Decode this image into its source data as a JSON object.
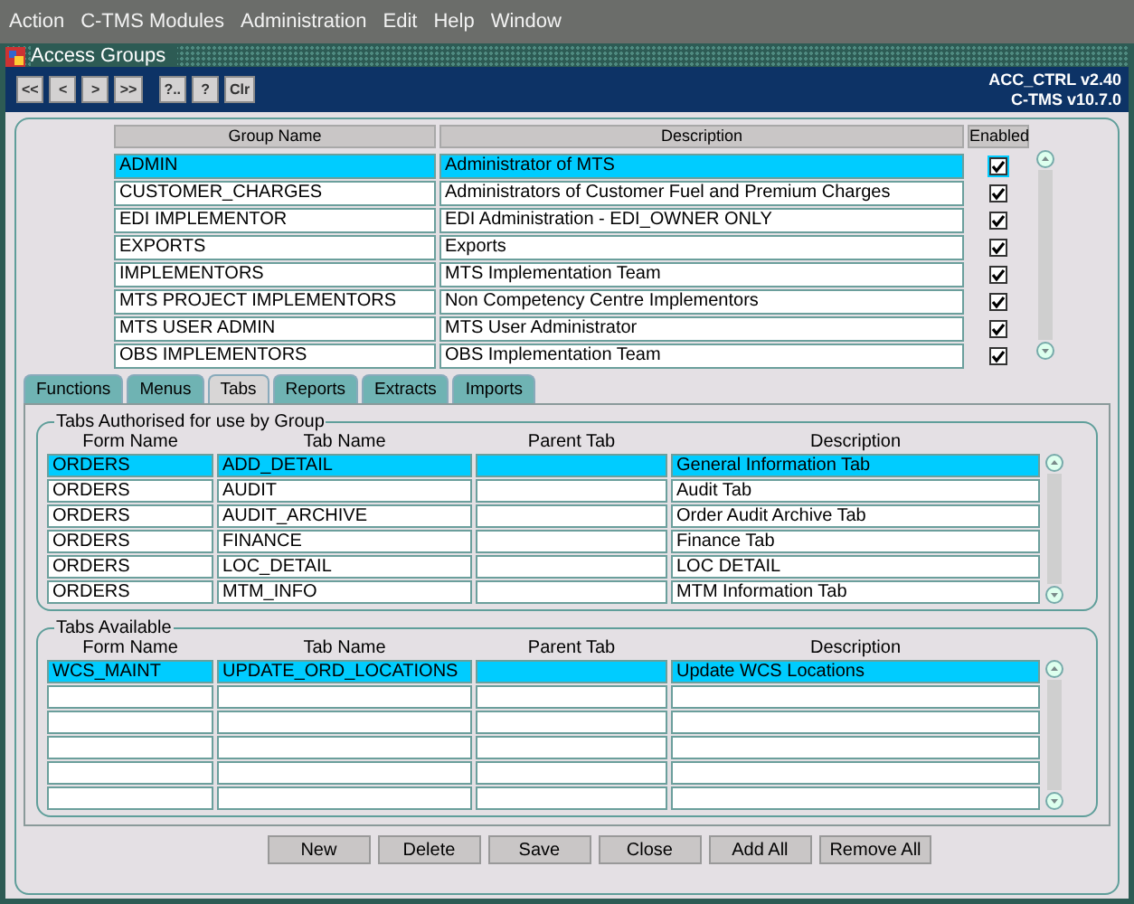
{
  "menu": [
    "Action",
    "C-TMS Modules",
    "Administration",
    "Edit",
    "Help",
    "Window"
  ],
  "window": {
    "title": "Access Groups"
  },
  "toolbar": {
    "buttons": [
      "<<",
      "<",
      ">",
      ">>",
      "?..",
      "?",
      "Clr"
    ],
    "version": "ACC_CTRL v2.40",
    "product": "C-TMS v10.7.0"
  },
  "groups": {
    "columns": [
      "Group Name",
      "Description",
      "Enabled"
    ],
    "rows": [
      {
        "name": "ADMIN",
        "description": "Administrator of MTS",
        "enabled": true,
        "selected": true
      },
      {
        "name": "CUSTOMER_CHARGES",
        "description": "Administrators of Customer Fuel and Premium Charges",
        "enabled": true,
        "selected": false
      },
      {
        "name": "EDI IMPLEMENTOR",
        "description": "EDI Administration - EDI_OWNER ONLY",
        "enabled": true,
        "selected": false
      },
      {
        "name": "EXPORTS",
        "description": "Exports",
        "enabled": true,
        "selected": false
      },
      {
        "name": "IMPLEMENTORS",
        "description": "MTS Implementation Team",
        "enabled": true,
        "selected": false
      },
      {
        "name": "MTS PROJECT IMPLEMENTORS",
        "description": "Non Competency Centre Implementors",
        "enabled": true,
        "selected": false
      },
      {
        "name": "MTS USER ADMIN",
        "description": "MTS User Administrator",
        "enabled": true,
        "selected": false
      },
      {
        "name": "OBS IMPLEMENTORS",
        "description": "OBS Implementation Team",
        "enabled": true,
        "selected": false
      }
    ]
  },
  "tabs": [
    {
      "label": "Functions",
      "selected": false
    },
    {
      "label": "Menus",
      "selected": false
    },
    {
      "label": "Tabs",
      "selected": true
    },
    {
      "label": "Reports",
      "selected": false
    },
    {
      "label": "Extracts",
      "selected": false
    },
    {
      "label": "Imports",
      "selected": false
    }
  ],
  "sections": [
    {
      "title": "Tabs Authorised for use by Group",
      "columns": [
        "Form Name",
        "Tab Name",
        "Parent Tab",
        "Description"
      ],
      "rows": [
        {
          "form": "ORDERS",
          "tab": "ADD_DETAIL",
          "description": "General Information Tab",
          "selected": true
        },
        {
          "form": "ORDERS",
          "tab": "AUDIT",
          "description": "Audit Tab",
          "selected": false
        },
        {
          "form": "ORDERS",
          "tab": "AUDIT_ARCHIVE",
          "description": "Order Audit Archive Tab",
          "selected": false
        },
        {
          "form": "ORDERS",
          "tab": "FINANCE",
          "description": "Finance Tab",
          "selected": false
        },
        {
          "form": "ORDERS",
          "tab": "LOC_DETAIL",
          "description": "LOC DETAIL",
          "selected": false
        },
        {
          "form": "ORDERS",
          "tab": "MTM_INFO",
          "description": "MTM Information Tab",
          "selected": false
        }
      ]
    },
    {
      "title": "Tabs Available",
      "columns": [
        "Form Name",
        "Tab Name",
        "Parent Tab",
        "Description"
      ],
      "rows": [
        {
          "form": "WCS_MAINT",
          "tab": "UPDATE_ORD_LOCATIONS",
          "description": "Update WCS Locations",
          "selected": true
        },
        {
          "selected": false
        },
        {
          "selected": false
        },
        {
          "selected": false
        },
        {
          "selected": false
        },
        {
          "selected": false
        }
      ]
    }
  ],
  "buttons": [
    "New",
    "Delete",
    "Save",
    "Close",
    "Add All",
    "Remove All"
  ]
}
